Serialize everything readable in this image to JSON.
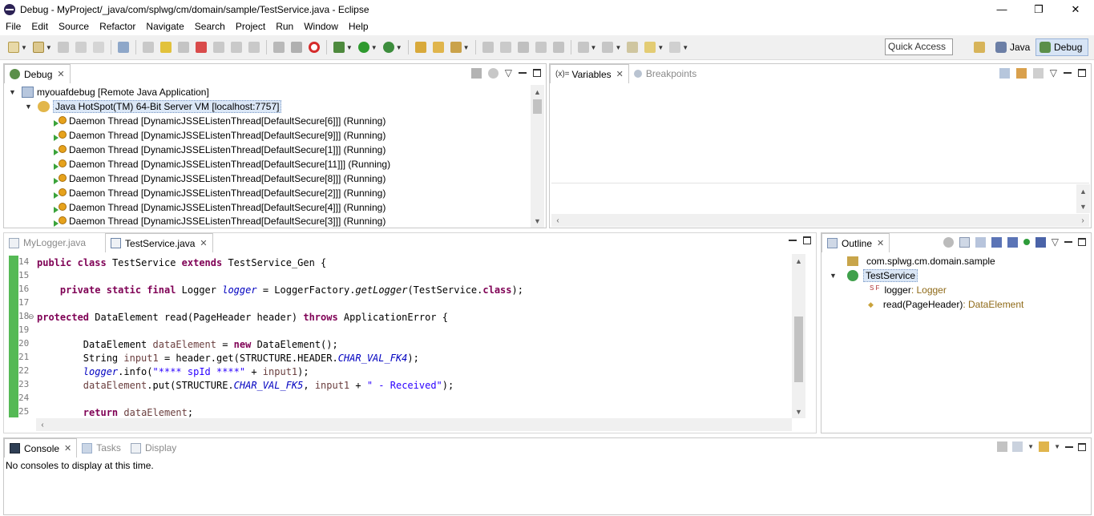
{
  "window": {
    "title": "Debug - MyProject/_java/com/splwg/cm/domain/sample/TestService.java - Eclipse",
    "controls": {
      "minimize": "—",
      "restore": "❐",
      "close": "✕"
    }
  },
  "menu": [
    "File",
    "Edit",
    "Source",
    "Refactor",
    "Navigate",
    "Search",
    "Project",
    "Run",
    "Window",
    "Help"
  ],
  "toolbar": {
    "quick_access_placeholder": "Quick Access",
    "perspectives": {
      "java": "Java",
      "debug": "Debug"
    }
  },
  "debug_view": {
    "tab_label": "Debug",
    "launch": "myouafdebug [Remote Java Application]",
    "vm": "Java HotSpot(TM) 64-Bit Server VM [localhost:7757]",
    "threads": [
      "Daemon Thread [DynamicJSSEListenThread[DefaultSecure[6]]] (Running)",
      "Daemon Thread [DynamicJSSEListenThread[DefaultSecure[9]]] (Running)",
      "Daemon Thread [DynamicJSSEListenThread[DefaultSecure[1]]] (Running)",
      "Daemon Thread [DynamicJSSEListenThread[DefaultSecure[11]]] (Running)",
      "Daemon Thread [DynamicJSSEListenThread[DefaultSecure[8]]] (Running)",
      "Daemon Thread [DynamicJSSEListenThread[DefaultSecure[2]]] (Running)",
      "Daemon Thread [DynamicJSSEListenThread[DefaultSecure[4]]] (Running)",
      "Daemon Thread [DynamicJSSEListenThread[DefaultSecure[3]]] (Running)"
    ]
  },
  "variables_view": {
    "tab_variables": "Variables",
    "tab_variables_prefix": "(x)=",
    "tab_breakpoints": "Breakpoints"
  },
  "editor": {
    "tabs": [
      {
        "label": "MyLogger.java"
      },
      {
        "label": "TestService.java"
      }
    ],
    "line_numbers": [
      "14",
      "15",
      "16",
      "17",
      "18",
      "19",
      "20",
      "21",
      "22",
      "23",
      "24",
      "25"
    ],
    "code": {
      "l14": [
        "public",
        " ",
        "class",
        " TestService ",
        "extends",
        " TestService_Gen {"
      ],
      "l16": [
        "    ",
        "private",
        " ",
        "static",
        " ",
        "final",
        " Logger ",
        "logger",
        " = LoggerFactory.",
        "getLogger",
        "(TestService.",
        "class",
        ");"
      ],
      "l18": [
        "protected",
        " DataElement read(PageHeader header) ",
        "throws",
        " ApplicationError {"
      ],
      "l20": [
        "        DataElement ",
        "dataElement",
        " = ",
        "new",
        " DataElement();"
      ],
      "l21": [
        "        String ",
        "input1",
        " = header.get(STRUCTURE.HEADER.",
        "CHAR_VAL_FK4",
        ");"
      ],
      "l22": [
        "        ",
        "logger",
        ".info(",
        "\"**** spId ****\"",
        " + ",
        "input1",
        ");"
      ],
      "l23": [
        "        ",
        "dataElement",
        ".put(STRUCTURE.",
        "CHAR_VAL_FK5",
        ", ",
        "input1",
        " + ",
        "\" - Received\"",
        ");"
      ],
      "l25": [
        "        ",
        "return",
        " ",
        "dataElement",
        ";"
      ]
    }
  },
  "outline_view": {
    "tab_label": "Outline",
    "package": "com.splwg.cm.domain.sample",
    "class_name": "TestService",
    "field_name": "logger",
    "field_type": " : Logger",
    "field_marker": "S F",
    "method_name": "read(PageHeader)",
    "method_type": " : DataElement"
  },
  "console_view": {
    "tab_console": "Console",
    "tab_tasks": "Tasks",
    "tab_display": "Display",
    "message": "No consoles to display at this time."
  },
  "colors": {
    "keyword": "#7f0055",
    "field": "#0000c0",
    "string": "#2a00ff",
    "selection": "#dbe7f6",
    "toolbar_bg": "#f0f0f0"
  }
}
